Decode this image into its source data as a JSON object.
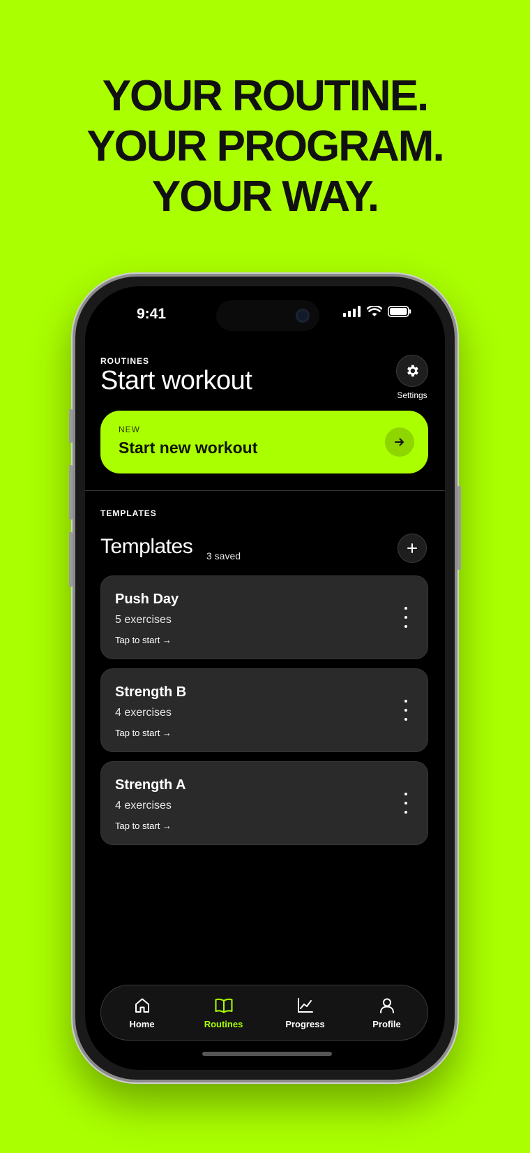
{
  "headline": [
    "YOUR ROUTINE.",
    "YOUR PROGRAM.",
    "YOUR WAY."
  ],
  "status": {
    "time": "9:41"
  },
  "header": {
    "section": "ROUTINES",
    "title": "Start workout",
    "settings_label": "Settings"
  },
  "new_workout": {
    "tag": "NEW",
    "title": "Start new workout"
  },
  "templates": {
    "section": "TEMPLATES",
    "title": "Templates",
    "count": "3 saved",
    "items": [
      {
        "name": "Push Day",
        "exercises": "5 exercises",
        "action": "Tap to start →"
      },
      {
        "name": "Strength B",
        "exercises": "4 exercises",
        "action": "Tap to start →"
      },
      {
        "name": "Strength A",
        "exercises": "4 exercises",
        "action": "Tap to start →"
      }
    ]
  },
  "tabs": [
    {
      "label": "Home",
      "icon": "home-icon",
      "active": false
    },
    {
      "label": "Routines",
      "icon": "book-icon",
      "active": true
    },
    {
      "label": "Progress",
      "icon": "chart-icon",
      "active": false
    },
    {
      "label": "Profile",
      "icon": "user-icon",
      "active": false
    }
  ],
  "colors": {
    "accent": "#aaff00",
    "background": "#000000",
    "card": "#2a2a2a"
  }
}
